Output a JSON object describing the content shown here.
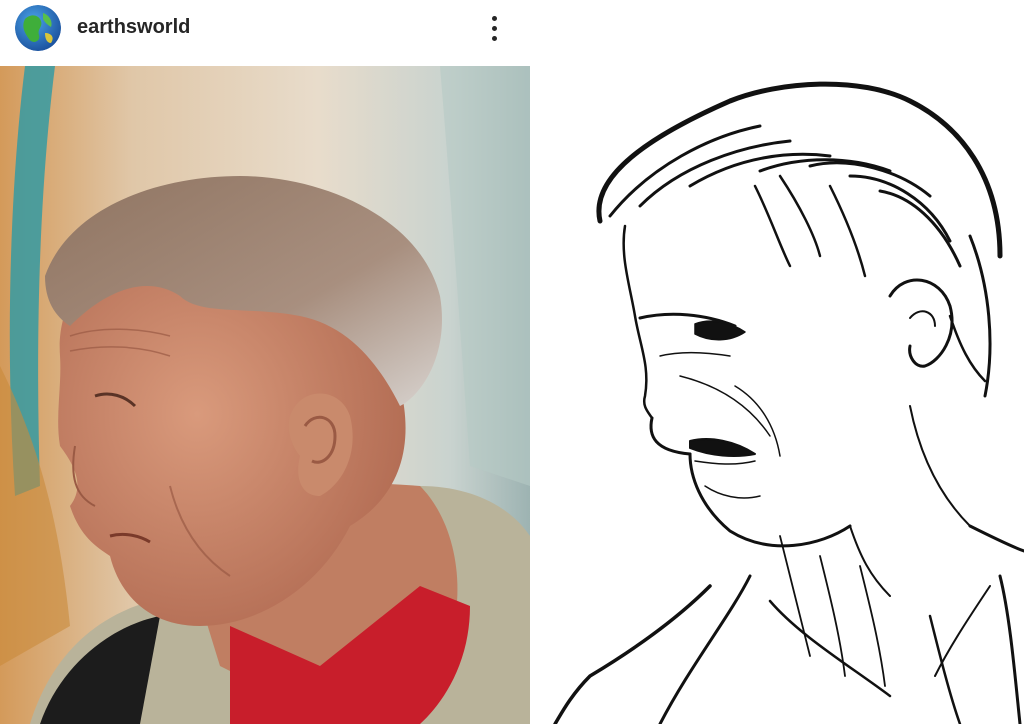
{
  "post": {
    "username": "earthsworld",
    "avatar_icon": "earth-globe-icon",
    "more_icon": "more-options-vertical-icon"
  },
  "images": {
    "photo": "portrait-photo-older-man-profile",
    "sketch": "line-art-sketch-of-portrait"
  },
  "colors": {
    "text": "#262626",
    "shirt_red": "#c81e2b",
    "jacket": "#b9b39a",
    "skin": "#c98a6c",
    "hair": "#9a8070"
  }
}
